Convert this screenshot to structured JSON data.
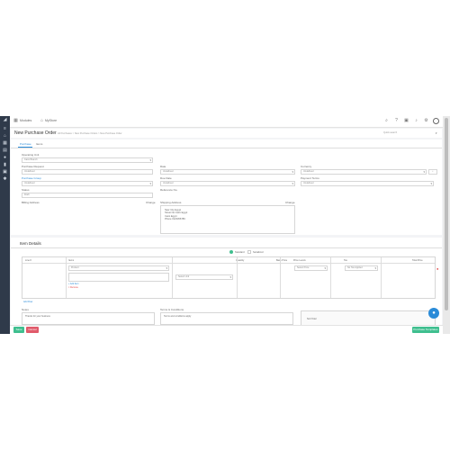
{
  "sidebar": {
    "icons": [
      "logo-icon",
      "menu-icon",
      "home-icon",
      "calendar-icon",
      "document-icon",
      "people-icon",
      "chart-icon",
      "box-icon",
      "gear-icon"
    ]
  },
  "topbar": {
    "module_label": "Modules",
    "store_label": "MyStore"
  },
  "page": {
    "title": "New Purchase Order",
    "breadcrumb": "All Purchases > New Purchase Orders > New Purchase Order",
    "search_placeholder": "Quick search"
  },
  "tabs": [
    "Purchase",
    "Items"
  ],
  "form": {
    "operating_unit_label": "Operating Unit",
    "operating_unit_value": "Cairo Branch",
    "purchase_request_label": "Purchase Request",
    "purchase_request_value": "Undefined",
    "purchase_group_label": "Purchase Group",
    "purchase_group_value": "Undefined",
    "status_label": "Status",
    "status_value": "Draft",
    "date_label": "Date",
    "date_value": "Undefined",
    "due_date_label": "Due Date",
    "due_date_value": "Undefined",
    "reference_label": "Reference No.",
    "currency_label": "Currency",
    "currency_value": "Undefined",
    "payment_terms_label": "Payment Terms",
    "payment_terms_value": "Undefined",
    "billing_address_label": "Billing Address",
    "shipping_address_label": "Shipping Address",
    "change_label": "Change",
    "shipping_address_lines": [
      "Nasr City Egypt",
      "Street No Cairo Egypt",
      "Cairo Egypt",
      "Phone 0123456789"
    ]
  },
  "items": {
    "title": "Item Details",
    "toggle_option_a": "Standard",
    "toggle_option_b": "Serialized",
    "columns": [
      "Line #",
      "Items",
      "Quantity",
      "Base Price",
      "Price Levels",
      "Tax",
      "Total Price"
    ],
    "item_placeholder": "Product",
    "unit_placeholder": "Select Unit",
    "price_level_value": "Select Price",
    "tax_value": "No Tax Applied",
    "add_item_label": "+ Add Item",
    "remove_label": "× Remove",
    "add_row_label": "Add Row"
  },
  "notes": {
    "notes_label": "Notes",
    "notes_value": "Thanks for your business",
    "terms_label": "Terms & Conditions",
    "terms_value": "Terms and conditions apply",
    "sub_total_label": "Sub Total"
  },
  "footer": {
    "save_label": "Save",
    "cancel_label": "Cancel",
    "save_and_send_label": "Purchase Templates"
  },
  "colors": {
    "sidebar": "#2f3a4a",
    "save": "#3fbf8f",
    "cancel": "#e05a6a",
    "accent": "#2a8bd8",
    "remove": "#e24848"
  }
}
